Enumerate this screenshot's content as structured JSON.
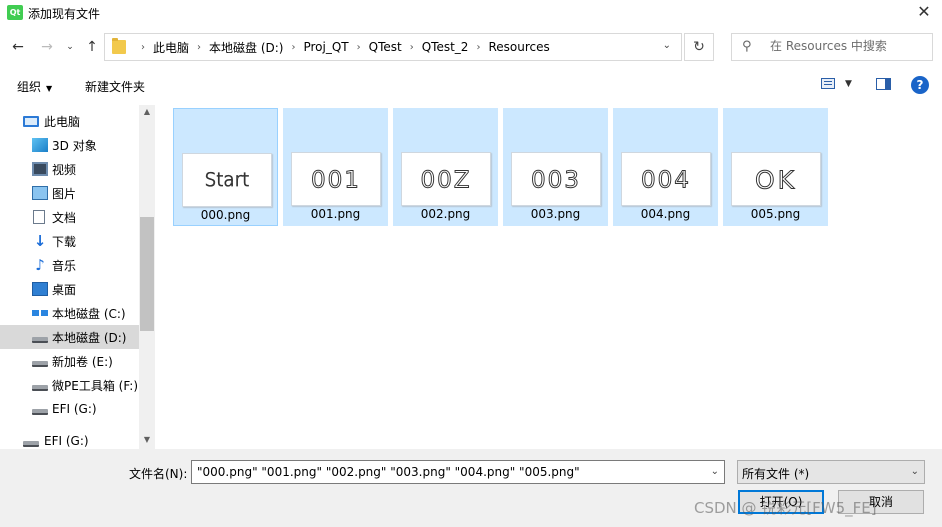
{
  "window": {
    "title": "添加现有文件",
    "app_icon_text": "Qt",
    "close_glyph": "✕"
  },
  "nav": {
    "back": "←",
    "forward": "→",
    "recent": "⌄",
    "up": "↑"
  },
  "address": {
    "crumbs": [
      "此电脑",
      "本地磁盘 (D:)",
      "Proj_QT",
      "QTest",
      "QTest_2",
      "Resources"
    ],
    "separator": "›",
    "dropdown": "⌄",
    "refresh": "↻"
  },
  "search": {
    "icon": "⚲",
    "placeholder": "在 Resources 中搜索"
  },
  "toolbar": {
    "organize_label": "组织",
    "organize_arrow": "▼",
    "new_folder_label": "新建文件夹",
    "view_dropdown": "▼",
    "help": "?"
  },
  "sidebar": {
    "items": [
      {
        "label": "此电脑",
        "icon": "computer-icon",
        "selected": false
      },
      {
        "label": "3D 对象",
        "icon": "3d-objects-icon",
        "selected": false
      },
      {
        "label": "视频",
        "icon": "videos-icon",
        "selected": false
      },
      {
        "label": "图片",
        "icon": "pictures-icon",
        "selected": false
      },
      {
        "label": "文档",
        "icon": "documents-icon",
        "selected": false
      },
      {
        "label": "下载",
        "icon": "download-icon",
        "selected": false
      },
      {
        "label": "音乐",
        "icon": "music-icon",
        "selected": false
      },
      {
        "label": "桌面",
        "icon": "desktop-icon",
        "selected": false
      },
      {
        "label": "本地磁盘 (C:)",
        "icon": "system-drive-icon",
        "selected": false
      },
      {
        "label": "本地磁盘 (D:)",
        "icon": "drive-icon",
        "selected": true
      },
      {
        "label": "新加卷 (E:)",
        "icon": "drive-icon",
        "selected": false
      },
      {
        "label": "微PE工具箱 (F:)",
        "icon": "drive-icon",
        "selected": false
      },
      {
        "label": "EFI (G:)",
        "icon": "drive-icon",
        "selected": false
      },
      {
        "label": "EFI (G:)",
        "icon": "drive-icon",
        "selected": false
      }
    ],
    "scroll_up": "▲",
    "scroll_down": "▼"
  },
  "files": [
    {
      "name": "000.png",
      "preview_text": "Start"
    },
    {
      "name": "001.png",
      "preview_text": "001"
    },
    {
      "name": "002.png",
      "preview_text": "00Z"
    },
    {
      "name": "003.png",
      "preview_text": "003"
    },
    {
      "name": "004.png",
      "preview_text": "004"
    },
    {
      "name": "005.png",
      "preview_text": "OK"
    }
  ],
  "footer": {
    "filename_label": "文件名(N):",
    "filename_value": "\"000.png\" \"001.png\" \"002.png\" \"003.png\" \"004.png\" \"005.png\"",
    "dropdown": "⌄",
    "filetype_value": "所有文件 (*)",
    "open_label": "打开(O)",
    "cancel_label": "取消"
  },
  "watermark": "CSDN @ 锐彩元[FW5_FE]",
  "colors": {
    "selection": "#cce8ff",
    "accent": "#0078d7",
    "help": "#1a64c8"
  }
}
